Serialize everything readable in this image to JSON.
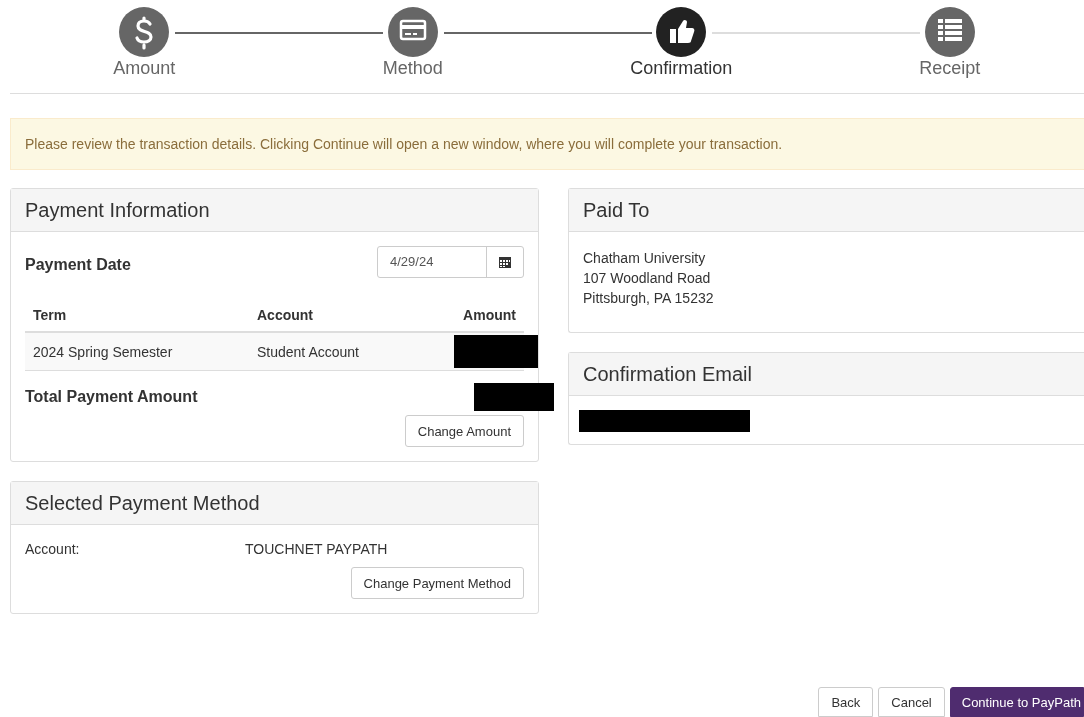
{
  "steps": [
    {
      "label": "Amount",
      "selected": false
    },
    {
      "label": "Method",
      "selected": false
    },
    {
      "label": "Confirmation",
      "selected": true
    },
    {
      "label": "Receipt",
      "selected": false
    }
  ],
  "alert": "Please review the transaction details. Clicking Continue will open a new window, where you will complete your transaction.",
  "payment_information": {
    "title": "Payment Information",
    "date_label": "Payment Date",
    "date_value": "4/29/24",
    "columns": [
      "Term",
      "Account",
      "Amount"
    ],
    "rows": [
      {
        "term": "2024 Spring Semester",
        "account": "Student Account",
        "amount_redacted": true
      }
    ],
    "total_label": "Total Payment Amount",
    "total_redacted": true,
    "button": "Change Amount"
  },
  "selected_payment_method": {
    "title": "Selected Payment Method",
    "label": "Account:",
    "value": "TOUCHNET PAYPATH",
    "button": "Change Payment Method"
  },
  "paid_to": {
    "title": "Paid To",
    "lines": [
      "Chatham University",
      "107 Woodland Road",
      "Pittsburgh, PA 15232"
    ]
  },
  "confirmation_email": {
    "title": "Confirmation Email",
    "email_redacted": true
  },
  "buttons": [
    {
      "label": "Back",
      "kind": "default"
    },
    {
      "label": "Cancel",
      "kind": "default"
    },
    {
      "label": "Continue to PayPath",
      "kind": "primary"
    }
  ]
}
